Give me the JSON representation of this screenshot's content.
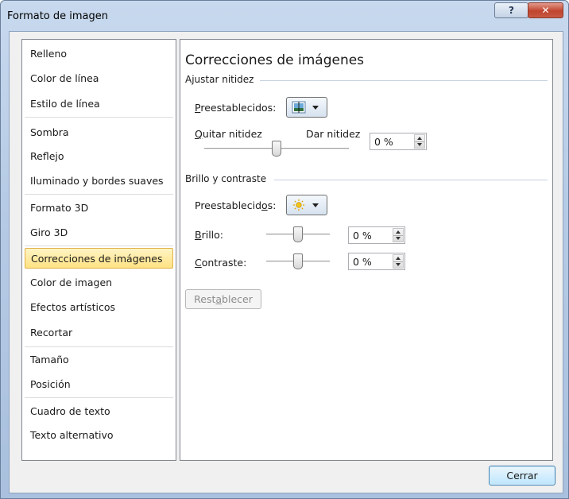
{
  "window": {
    "title": "Formato de imagen",
    "help_glyph": "?",
    "close_glyph": "✕"
  },
  "nav": {
    "items": [
      {
        "label": "Relleno"
      },
      {
        "label": "Color de línea"
      },
      {
        "label": "Estilo de línea"
      },
      {
        "label": "Sombra"
      },
      {
        "label": "Reflejo"
      },
      {
        "label": "Iluminado y bordes suaves"
      },
      {
        "label": "Formato 3D"
      },
      {
        "label": "Giro 3D"
      },
      {
        "label": "Correcciones de imágenes",
        "selected": true
      },
      {
        "label": "Color de imagen"
      },
      {
        "label": "Efectos artísticos"
      },
      {
        "label": "Recortar"
      },
      {
        "label": "Tamaño"
      },
      {
        "label": "Posición"
      },
      {
        "label": "Cuadro de texto"
      },
      {
        "label": "Texto alternativo"
      }
    ]
  },
  "panel": {
    "title": "Correcciones de imágenes",
    "sharpness": {
      "section_label": "Ajustar nitidez",
      "presets_label": "Preestablecidos:",
      "preset_icon": "sharpness-preset-icon",
      "left_label": "Quitar nitidez",
      "right_label": "Dar nitidez",
      "value": "0 %",
      "slider_position": 0.5
    },
    "brightness_contrast": {
      "section_label": "Brillo y contraste",
      "presets_label_start": "Preestablecid",
      "presets_label_key": "o",
      "presets_label_end": "s:",
      "preset_icon": "sun-icon",
      "brightness": {
        "label_key": "B",
        "label_rest": "rillo:",
        "value": "0 %",
        "slider_position": 0.5
      },
      "contrast": {
        "label_key": "C",
        "label_rest": "ontraste:",
        "value": "0 %",
        "slider_position": 0.5
      }
    },
    "reset_label_start": "Rest",
    "reset_label_key": "a",
    "reset_label_end": "blecer"
  },
  "footer": {
    "close_label": "Cerrar"
  },
  "colors": {
    "selected_bg": "#ffe283",
    "accent": "#3c7fb1",
    "close_button": "#c0442d"
  }
}
